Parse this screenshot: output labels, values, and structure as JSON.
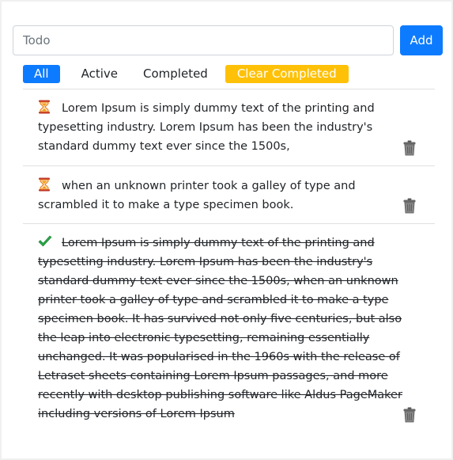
{
  "input": {
    "placeholder": "Todo",
    "value": ""
  },
  "add_button": {
    "label": "Add"
  },
  "filters": {
    "all": "All",
    "active": "Active",
    "completed": "Completed",
    "clear_completed": "Clear Completed",
    "selected": "All"
  },
  "todos": [
    {
      "status": "pending",
      "status_icon": "hourglass-icon",
      "text": "Lorem Ipsum is simply dummy text of the printing and typesetting industry. Lorem Ipsum has been the industry's standard dummy text ever since the 1500s,"
    },
    {
      "status": "pending",
      "status_icon": "hourglass-icon",
      "text": "when an unknown printer took a galley of type and scrambled it to make a type specimen book."
    },
    {
      "status": "completed",
      "status_icon": "check-icon",
      "text": "Lorem Ipsum is simply dummy text of the printing and typesetting industry. Lorem Ipsum has been the industry's standard dummy text ever since the 1500s, when an unknown printer took a galley of type and scrambled it to make a type specimen book. It has survived not only five centuries, but also the leap into electronic typesetting, remaining essentially unchanged. It was popularised in the 1960s with the release of Letraset sheets containing Lorem Ipsum passages, and more recently with desktop publishing software like Aldus PageMaker including versions of Lorem Ipsum"
    }
  ],
  "colors": {
    "primary": "#0d7bff",
    "warning": "#ffc107",
    "check": "#28a745",
    "hourglass": "#e8730c"
  }
}
